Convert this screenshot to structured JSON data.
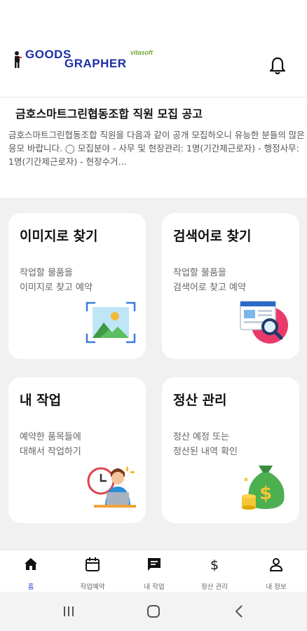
{
  "header": {
    "logo_line1": "GOODS",
    "logo_line2": "GRAPHER",
    "logo_tag": "vitasoft"
  },
  "notice": {
    "title": "금호스마트그린협동조합 직원 모집 공고",
    "body": "금호스마트그린협동조합 직원을 다음과 같이 공개 모집하오니 유능한 분들의 많은 응모 바랍니다.     ◯ 모집분야   - 사무 및 현장관리: 1명(기간제근로자)   - 행정사무: 1명(기간제근로자)   - 현장수거..."
  },
  "cards": [
    {
      "title": "이미지로 찾기",
      "desc1": "작업할 물품을",
      "desc2": "이미지로 찾고 예약",
      "icon": "image-search-icon"
    },
    {
      "title": "검색어로 찾기",
      "desc1": "작업할 물품을",
      "desc2": "검색어로 찾고 예약",
      "icon": "keyword-search-icon"
    },
    {
      "title": "내 작업",
      "desc1": "예약한 품목들에",
      "desc2": "대해서 작업하기",
      "icon": "worker-laptop-icon"
    },
    {
      "title": "정산 관리",
      "desc1": "정산 예정 또는",
      "desc2": "정산된 내역 확인",
      "icon": "money-bag-icon"
    }
  ],
  "tabs": [
    {
      "label": "홈",
      "icon": "home-icon",
      "active": true
    },
    {
      "label": "작업예약",
      "icon": "calendar-icon"
    },
    {
      "label": "내 작업",
      "icon": "chat-icon"
    },
    {
      "label": "정산 관리",
      "icon": "dollar-icon"
    },
    {
      "label": "내 정보",
      "icon": "person-icon"
    }
  ],
  "colors": {
    "brand": "#1d2fa6",
    "accent": "#2b4bd6",
    "background": "#f1f1f1"
  }
}
